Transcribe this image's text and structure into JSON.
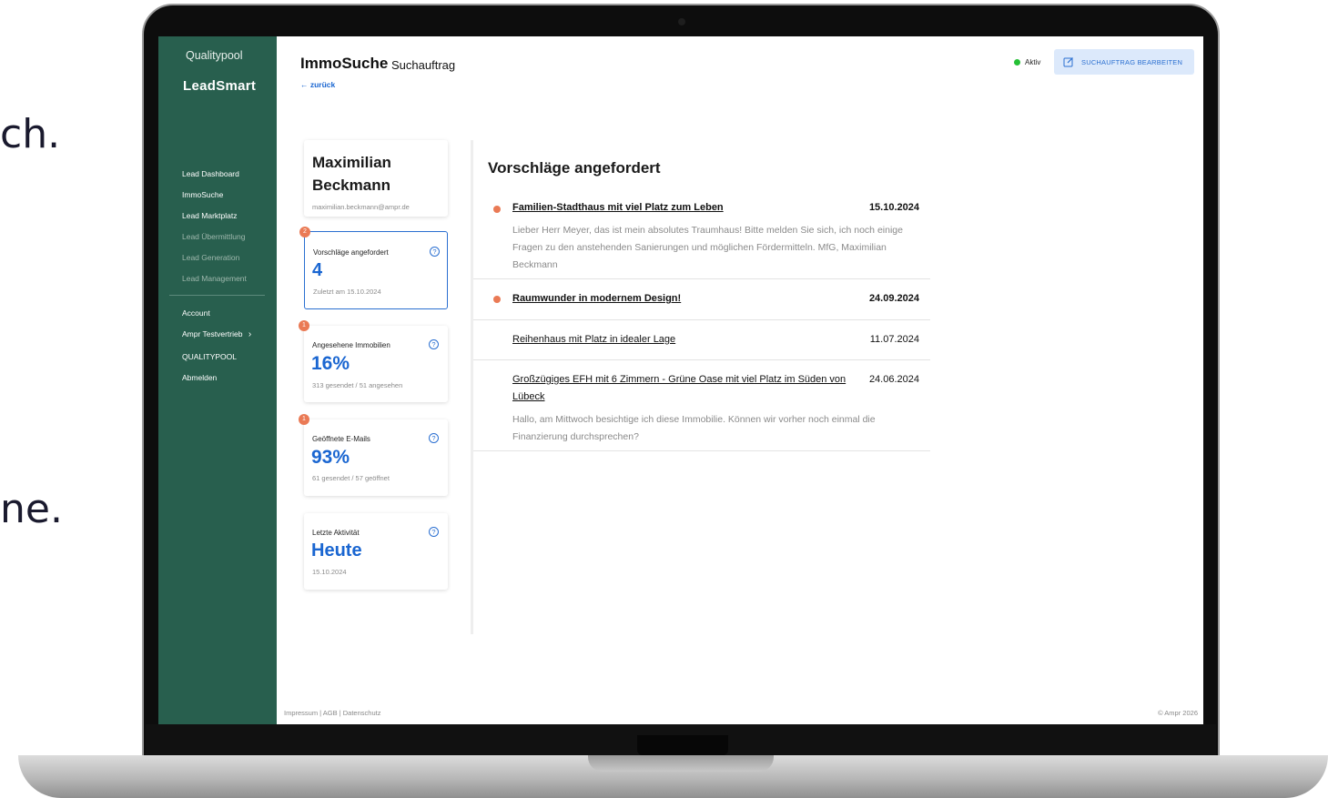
{
  "background": {
    "line1": "ch.",
    "line2": "ne."
  },
  "sidebar": {
    "brand_top": "Qualitypool",
    "brand_main": "LeadSmart",
    "items": [
      {
        "label": "Lead Dashboard",
        "muted": false
      },
      {
        "label": "ImmoSuche",
        "muted": false
      },
      {
        "label": "Lead Marktplatz",
        "muted": false
      },
      {
        "label": "Lead Übermittlung",
        "muted": true
      },
      {
        "label": "Lead Generation",
        "muted": true
      },
      {
        "label": "Lead Management",
        "muted": true
      }
    ],
    "account_items": [
      {
        "label": "Account"
      },
      {
        "label": "Ampr Testvertrieb",
        "chevron": "chevron-right-icon"
      },
      {
        "label": "QUALITYPOOL"
      },
      {
        "label": "Abmelden"
      }
    ]
  },
  "header": {
    "title": "ImmoSuche",
    "subtitle": "Suchauftrag",
    "back": "← zurück",
    "status_label": "Aktiv",
    "status_color": "#25c035",
    "edit_button": "SUCHAUFTRAG BEARBEITEN",
    "edit_icon": "edit-icon"
  },
  "person": {
    "name_line1": "Maximilian",
    "name_line2": "Beckmann",
    "email": "maximilian.beckmann@ampr.de"
  },
  "stats": [
    {
      "badge": "2",
      "title": "Vorschläge angefordert",
      "value": "4",
      "sub": "Zuletzt am 15.10.2024",
      "active": true
    },
    {
      "badge": "1",
      "title": "Angesehene Immobilien",
      "value": "16%",
      "sub": "313 gesendet / 51 angesehen",
      "active": false
    },
    {
      "badge": "1",
      "title": "Geöffnete E-Mails",
      "value": "93%",
      "sub": "61 gesendet / 57 geöffnet",
      "active": false
    },
    {
      "badge": "",
      "title": "Letzte Aktivität",
      "value": "Heute",
      "sub": "15.10.2024",
      "active": false
    }
  ],
  "proposals": {
    "heading": "Vorschläge angefordert",
    "items": [
      {
        "title": "Familien-Stadthaus mit viel Platz zum Leben",
        "date": "15.10.2024",
        "unread": true,
        "message": "Lieber Herr Meyer, das ist mein absolutes Traumhaus! Bitte melden Sie sich, ich noch einige Fragen zu den anstehenden Sanierungen und möglichen Fördermitteln. MfG, Maximilian Beckmann"
      },
      {
        "title": "Raumwunder in modernem Design!",
        "date": "24.09.2024",
        "unread": true,
        "message": ""
      },
      {
        "title": "Reihenhaus mit Platz in idealer Lage",
        "date": "11.07.2024",
        "unread": false,
        "message": ""
      },
      {
        "title": "Großzügiges EFH mit 6 Zimmern - Grüne Oase mit viel Platz im Süden von Lübeck",
        "date": "24.06.2024",
        "unread": false,
        "message": "Hallo, am Mittwoch besichtige ich diese Immobilie. Können wir vorher noch einmal die Finanzierung durchsprechen?"
      }
    ]
  },
  "footer": {
    "links": [
      "Impressum",
      "AGB",
      "Datenschutz"
    ],
    "copyright": "© Ampr 2026"
  },
  "colors": {
    "sidebar": "#285f4e",
    "accent": "#1a66d1",
    "badge": "#ea7a55"
  }
}
